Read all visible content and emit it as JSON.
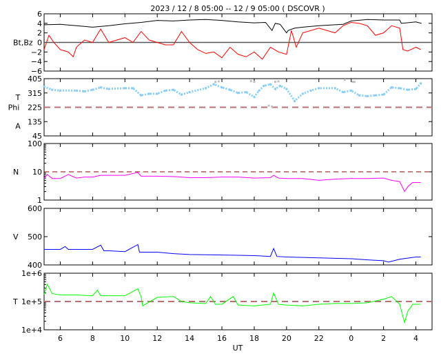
{
  "chart_data": [
    {
      "type": "line",
      "title": "2023 / 12 /  8   05:00 -- 12 /  9   05:00 ( DSCOVR )",
      "ylabel": "Bt,Bz",
      "ylim": [
        -6,
        6
      ],
      "yticks": [
        "6",
        "4",
        "2",
        "0",
        "−2",
        "−4",
        "−6"
      ],
      "ytick_values": [
        6,
        4,
        2,
        0,
        -2,
        -4,
        -6
      ],
      "reference_line": 0,
      "series": [
        {
          "name": "Bt",
          "color": "#000000",
          "x": [
            5,
            6,
            7,
            8,
            9,
            10,
            11,
            12,
            13,
            14,
            15,
            16,
            17,
            18,
            18.7,
            19.1,
            19.3,
            19.6,
            20.0,
            20.1,
            20.5,
            21,
            22,
            23,
            23.5,
            24,
            25,
            26,
            27,
            27.1,
            28,
            28.35
          ],
          "y": [
            3.7,
            3.8,
            3.5,
            3.2,
            3.5,
            3.9,
            4.2,
            4.6,
            4.5,
            4.7,
            4.8,
            4.6,
            4.3,
            4.1,
            4.2,
            2.5,
            4.0,
            3.8,
            2.0,
            2.5,
            3.0,
            3.2,
            3.5,
            3.7,
            3.8,
            4.5,
            4.8,
            4.7,
            4.7,
            4.0,
            4.3,
            4.0
          ]
        },
        {
          "name": "Bz",
          "color": "#ff0000",
          "x": [
            5,
            5.3,
            5.6,
            6,
            6.5,
            6.8,
            7,
            7.5,
            8,
            8.5,
            9,
            9.5,
            10,
            10.5,
            11,
            11.5,
            12,
            12.5,
            13,
            13.5,
            14,
            14.5,
            15,
            15.5,
            16,
            16.5,
            17,
            17.5,
            18,
            18.5,
            19,
            19.5,
            20,
            20.3,
            20.6,
            21,
            21.5,
            22,
            22.5,
            23,
            23.5,
            24,
            24.5,
            25,
            25.5,
            26,
            26.5,
            27,
            27.2,
            27.5,
            28,
            28.3
          ],
          "y": [
            -1.5,
            1.5,
            0,
            -1.5,
            -2,
            -3,
            -1,
            0.5,
            0,
            2.8,
            0,
            0.5,
            1,
            0,
            2.3,
            0.5,
            0,
            -0.5,
            -0.5,
            2.3,
            0,
            -1.5,
            -2.3,
            -2,
            -3.2,
            -1,
            -2.5,
            -3,
            -2,
            -3.5,
            -1,
            -2,
            -2.5,
            2.5,
            -1,
            2,
            2.5,
            3,
            2.5,
            2,
            3.5,
            4.2,
            4,
            3.5,
            1.5,
            2,
            3.5,
            3,
            -1.5,
            -1.8,
            -1,
            -1.5
          ]
        }
      ]
    },
    {
      "type": "scatter",
      "ylabel_lines": [
        "T",
        "Phi",
        "A"
      ],
      "ylim": [
        45,
        405
      ],
      "yticks": [
        "405",
        "315",
        "225",
        "135",
        "45"
      ],
      "ytick_values": [
        405,
        315,
        225,
        135,
        45
      ],
      "reference_line": 225,
      "series": [
        {
          "name": "Phi",
          "color": "#87cefa",
          "x": [
            5,
            5.5,
            6,
            7,
            7.5,
            8,
            8.5,
            9,
            10,
            10.5,
            11,
            11.5,
            12,
            12.5,
            13,
            13.5,
            14,
            15,
            15.5,
            16,
            16.5,
            17,
            17.5,
            18,
            18.3,
            18.6,
            19,
            19.3,
            19.6,
            20,
            20.5,
            21,
            21.5,
            22,
            23,
            23.5,
            24,
            24.5,
            25,
            25.5,
            26,
            26.5,
            27,
            27.5,
            28,
            28.3
          ],
          "y": [
            355,
            335,
            330,
            330,
            325,
            335,
            350,
            340,
            345,
            345,
            300,
            310,
            310,
            330,
            335,
            305,
            320,
            345,
            370,
            350,
            335,
            315,
            320,
            290,
            330,
            360,
            370,
            340,
            360,
            340,
            265,
            310,
            330,
            345,
            345,
            320,
            330,
            300,
            295,
            300,
            305,
            350,
            345,
            335,
            340,
            375
          ]
        },
        {
          "name": "Phi-gray",
          "color": "#c0c0c0",
          "x": [
            15.6,
            15.8,
            17.8,
            18.0,
            18.9,
            19.1,
            19.3,
            19.5,
            23.6,
            24.1,
            24.2
          ],
          "y": [
            385,
            388,
            390,
            385,
            235,
            230,
            385,
            388,
            398,
            385,
            385
          ]
        }
      ]
    },
    {
      "type": "line",
      "ylabel": "N",
      "scale": "log",
      "ylim": [
        1,
        100
      ],
      "yticks": [
        "100",
        "10",
        "1"
      ],
      "ytick_values": [
        100,
        10,
        1
      ],
      "reference_line": 10,
      "series": [
        {
          "name": "N",
          "color": "#ff00ff",
          "x": [
            5,
            5.2,
            5.5,
            6,
            6.5,
            7,
            7.5,
            8,
            8.5,
            9,
            10,
            10.8,
            11,
            12,
            13,
            14,
            15,
            16,
            17,
            18,
            19,
            19.2,
            19.5,
            20,
            21,
            22,
            23,
            24,
            25,
            26,
            26.5,
            27,
            27.3,
            27.5,
            27.8,
            28.3
          ],
          "y": [
            6,
            8,
            5.8,
            5.8,
            8,
            6,
            6.5,
            6.5,
            7.5,
            7.5,
            7.5,
            9.5,
            7,
            7,
            6.8,
            6.2,
            6.2,
            6.5,
            6.5,
            6,
            6.2,
            7.5,
            6,
            5.8,
            5.8,
            5,
            5.5,
            5.8,
            5.8,
            6,
            5,
            4.5,
            2,
            3,
            4.2,
            4.2
          ]
        }
      ]
    },
    {
      "type": "line",
      "ylabel": "V",
      "ylim": [
        400,
        600
      ],
      "yticks": [
        "600",
        "500",
        "400"
      ],
      "ytick_values": [
        600,
        500,
        400
      ],
      "series": [
        {
          "name": "V",
          "color": "#0000ff",
          "x": [
            5,
            6,
            6.3,
            6.5,
            8,
            8.5,
            8.7,
            9,
            10,
            10.8,
            10.9,
            11.2,
            12,
            13,
            14,
            15,
            16,
            17,
            18,
            19,
            19.2,
            19.4,
            20,
            22,
            24,
            25,
            26,
            26.3,
            27,
            28,
            28.3
          ],
          "y": [
            455,
            455,
            465,
            455,
            455,
            470,
            450,
            450,
            447,
            472,
            445,
            445,
            445,
            440,
            437,
            436,
            435,
            434,
            433,
            430,
            458,
            430,
            428,
            425,
            422,
            418,
            415,
            410,
            420,
            428,
            428
          ]
        }
      ]
    },
    {
      "type": "line",
      "ylabel": "T",
      "xlabel": "UT",
      "scale": "log",
      "ylim": [
        10000,
        1000000
      ],
      "yticks": [
        "1e+6",
        "1e+5",
        "1e+4"
      ],
      "ytick_values": [
        1000000,
        100000,
        10000
      ],
      "reference_line": 100000,
      "xticks": [
        "6",
        "8",
        "10",
        "12",
        "14",
        "16",
        "18",
        "20",
        "22",
        "0",
        "2",
        "4"
      ],
      "xtick_hours": [
        6,
        8,
        10,
        12,
        14,
        16,
        18,
        20,
        22,
        24,
        26,
        28
      ],
      "xlim_hours": [
        5,
        29
      ],
      "series": [
        {
          "name": "T",
          "color": "#00ff00",
          "x": [
            5,
            5.2,
            5.5,
            6,
            7,
            8,
            8.3,
            8.5,
            10,
            10.8,
            11,
            11.1,
            12,
            13,
            13.5,
            14,
            15,
            15.3,
            15.6,
            16,
            16.7,
            17,
            18,
            19,
            19.2,
            19.5,
            20,
            21,
            22,
            23,
            24,
            25,
            26,
            26.5,
            27,
            27.3,
            27.5,
            27.8,
            28.3
          ],
          "y": [
            180000,
            400000,
            190000,
            170000,
            170000,
            160000,
            250000,
            160000,
            160000,
            280000,
            150000,
            70000,
            140000,
            150000,
            100000,
            90000,
            85000,
            150000,
            80000,
            80000,
            150000,
            75000,
            70000,
            80000,
            200000,
            80000,
            75000,
            70000,
            80000,
            85000,
            85000,
            90000,
            120000,
            150000,
            80000,
            18000,
            45000,
            80000,
            80000
          ]
        }
      ]
    }
  ]
}
